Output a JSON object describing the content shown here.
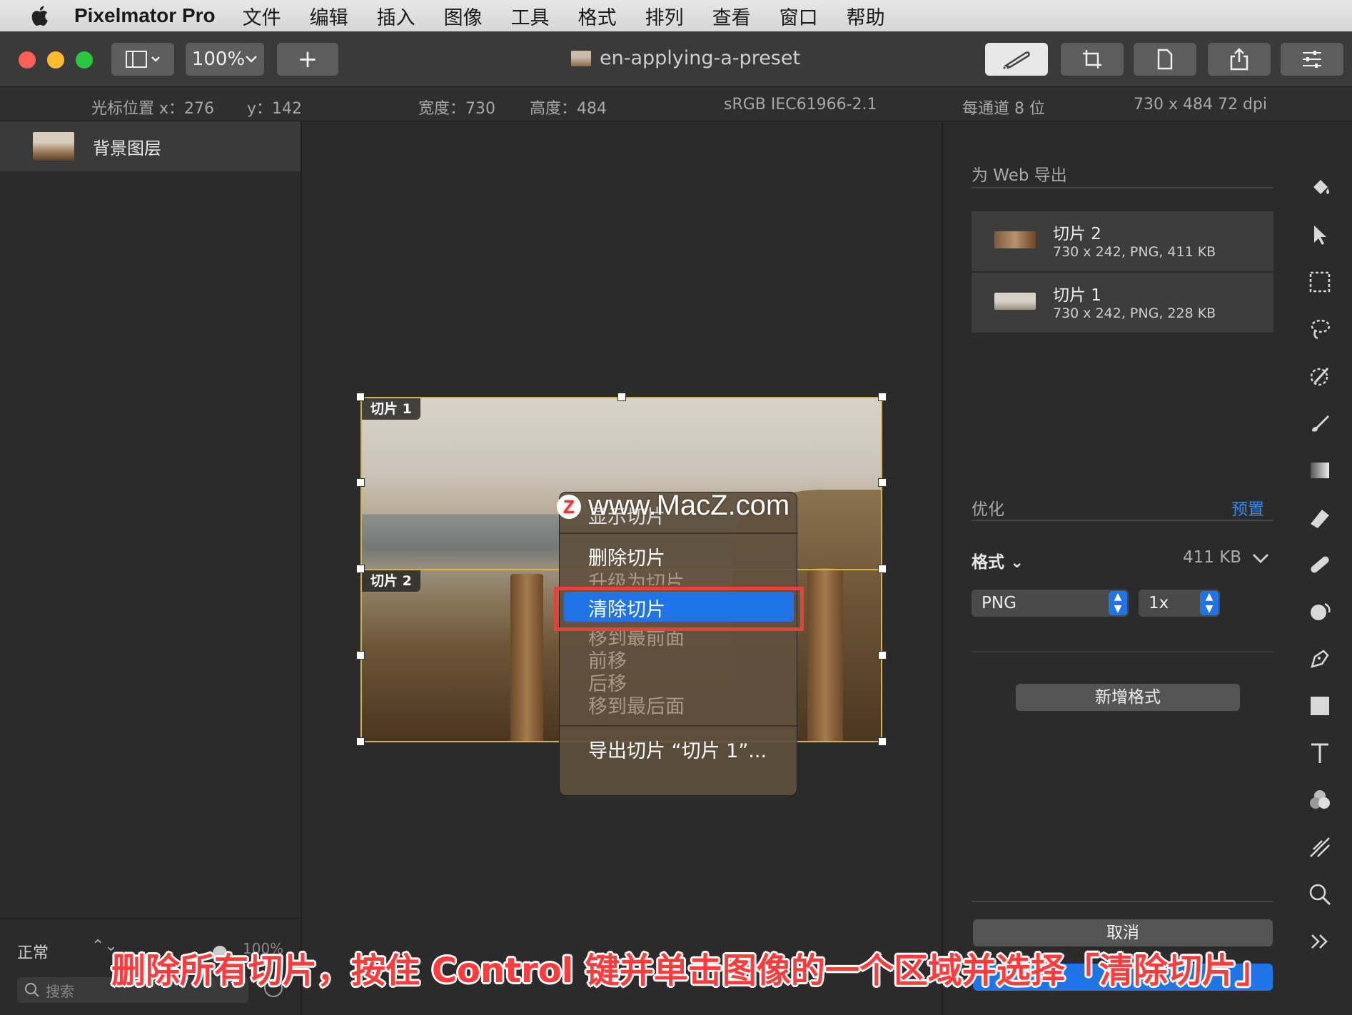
{
  "menubar": {
    "app_name": "Pixelmator Pro",
    "items": [
      "文件",
      "编辑",
      "插入",
      "图像",
      "工具",
      "格式",
      "排列",
      "查看",
      "窗口",
      "帮助"
    ]
  },
  "titlebar": {
    "zoom": "100%",
    "add_label": "+",
    "document_title": "en-applying-a-preset"
  },
  "infobar": {
    "cursor_x": "光标位置 x：276",
    "cursor_y": "y：142",
    "width": "宽度：730",
    "height": "高度：484",
    "color_profile": "sRGB IEC61966-2.1",
    "bit_depth": "每通道 8 位",
    "dimensions": "730 x 484 72 dpi"
  },
  "layers": {
    "items": [
      {
        "name": "背景图层"
      }
    ],
    "blend_mode": "正常",
    "opacity": "100%",
    "search_placeholder": "搜索"
  },
  "canvas": {
    "slice_tags": [
      "切片 1",
      "切片 2"
    ]
  },
  "context_menu": {
    "header_partial": "显示切片",
    "items": [
      {
        "label": "删除切片",
        "enabled": true
      },
      {
        "label": "升级为切片",
        "enabled": false
      },
      {
        "label": "清除切片",
        "enabled": true,
        "highlighted": true
      },
      {
        "label": "移到最前面",
        "enabled": false
      },
      {
        "label": "前移",
        "enabled": false
      },
      {
        "label": "后移",
        "enabled": false
      },
      {
        "label": "移到最后面",
        "enabled": false
      },
      {
        "label": "导出切片 “切片 1”...",
        "enabled": true
      }
    ]
  },
  "watermark": {
    "logo": "Z",
    "text": "www.MacZ.com"
  },
  "export_panel": {
    "heading": "为 Web 导出",
    "slices": [
      {
        "name": "切片 2",
        "meta": "730 x 242, PNG, 411 KB"
      },
      {
        "name": "切片 1",
        "meta": "730 x 242, PNG, 228 KB"
      }
    ],
    "optimize_label": "优化",
    "preset_label": "预置",
    "format_label": "格式",
    "format_size": "411 KB",
    "format_value": "PNG",
    "scale_value": "1x",
    "add_format_label": "新增格式",
    "cancel_label": "取消"
  },
  "tools": [
    "paint-bucket-icon",
    "arrow-select-icon",
    "rect-select-icon",
    "lasso-icon",
    "magic-wand-icon",
    "brush-icon",
    "gradient-icon",
    "eraser-icon",
    "bandage-icon",
    "blur-icon",
    "pen-icon",
    "shape-icon",
    "type-icon",
    "color-adjust-icon",
    "slice-icon",
    "zoom-icon",
    "more-icon"
  ],
  "caption": "删除所有切片，按住 Control 键并单击图像的一个区域并选择「清除切片」",
  "colors": {
    "accent": "#1f74e8",
    "highlight_box": "#e8413a",
    "slice_border": "#d8b447",
    "caption": "#ff3b3b"
  }
}
